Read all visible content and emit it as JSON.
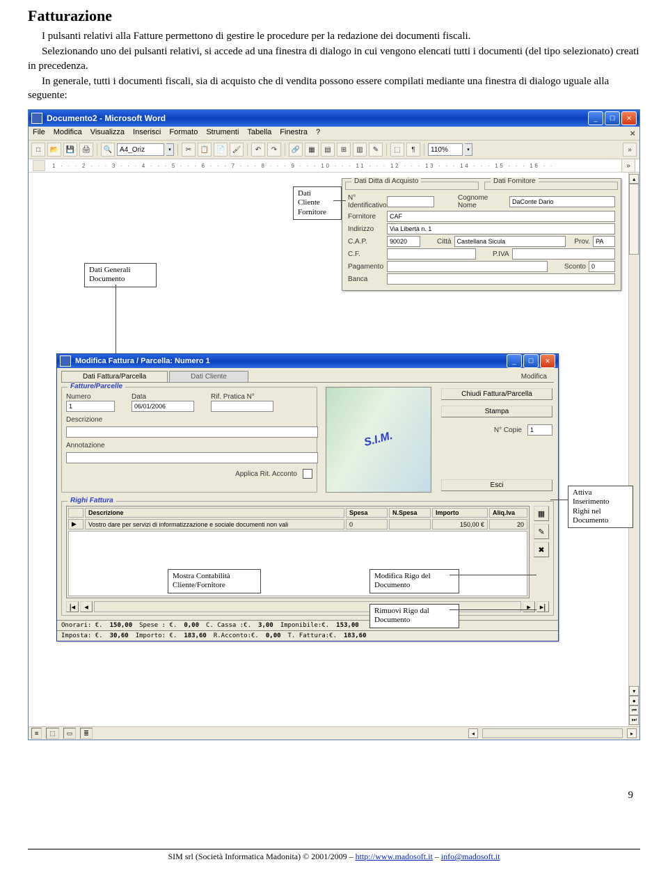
{
  "heading": "Fatturazione",
  "para1": "I pulsanti relativi alla Fatture permettono di gestire le procedure per la redazione dei documenti fiscali.",
  "para2": "Selezionando uno dei pulsanti relativi, si accede ad una finestra di dialogo in cui vengono elencati tutti i documenti (del tipo selezionato) creati in precedenza.",
  "para3": "In generale, tutti i documenti fiscali, sia di acquisto che di vendita possono essere compilati mediante una finestra di dialogo uguale alla seguente:",
  "word": {
    "title": "Documento2 - Microsoft Word",
    "menu": [
      "File",
      "Modifica",
      "Visualizza",
      "Inserisci",
      "Formato",
      "Strumenti",
      "Tabella",
      "Finestra",
      "?"
    ],
    "page_size": "A4_Oriz",
    "zoom": "110%",
    "ruler": "1 · · · 2 · · · 3 · · · 4 · · · 5 · · · 6 · · · 7 · · · 8 · · · 9 · · · 10 · · · 11 · · · 12 · · · 13 · · · 14 · · · 15 · · · 16 · ·"
  },
  "callouts": {
    "dati_cliente": "Dati\nCliente\nFornitore",
    "dati_generali": "Dati Generali\nDocumento",
    "attiva": "Attiva\nInserimento\nRighi nel\nDocumento",
    "mostra": "Mostra Contabilità\nCliente/Fornitore",
    "modifica_rigo": "Modifica Rigo del\nDocumento",
    "rimuovi_rigo": "Rimuovi Rigo dal\nDocumento"
  },
  "ditta": {
    "group1": "Dati Ditta di Acquisto",
    "group2": "Dati Fornitore",
    "nid": "N° Identificativo",
    "nid_val": "",
    "cognome": "Cognome Nome",
    "cognome_val": "DaConte Dario",
    "fornitore": "Fornitore",
    "fornitore_val": "CAF",
    "indirizzo": "Indirizzo",
    "indirizzo_val": "Via Libertà n. 1",
    "cap": "C.A.P.",
    "cap_val": "90020",
    "citta": "Città",
    "citta_val": "Castellana Sicula",
    "prov": "Prov.",
    "prov_val": "PA",
    "cf": "C.F.",
    "piva": "P.IVA",
    "pagamento": "Pagamento",
    "sconto": "Sconto",
    "sconto_val": "0",
    "banca": "Banca"
  },
  "dialog": {
    "title": "Modifica Fattura / Parcella: Numero 1",
    "tab1": "Dati Fattura/Parcella",
    "tab2": "Dati Cliente",
    "tab_mod": "Modifica",
    "section": "Fatture/Parcelle",
    "numero": "Numero",
    "numero_val": "1",
    "data": "Data",
    "data_val": "06/01/2006",
    "rif": "Rif. Pratica N°",
    "descrizione": "Descrizione",
    "annotazione": "Annotazione",
    "applica": "Applica Rit. Acconto",
    "sim": "S.I.M.",
    "btn_chiudi": "Chiudi Fattura/Parcella",
    "btn_stampa": "Stampa",
    "ncopie": "N° Copie",
    "ncopie_val": "1",
    "btn_esci": "Esci",
    "righi": "Righi Fattura",
    "cols": [
      "",
      "Descrizione",
      "Spesa",
      "N.Spesa",
      "Importo",
      "Aliq.Iva"
    ],
    "row": [
      "▶",
      "Vostro dare per servizi di informatizzazione e sociale documenti non vali",
      "0",
      "",
      "150,00 €",
      "20"
    ],
    "totals_top": [
      "Onorari: €.",
      "150,00",
      "Spese   : €.",
      "0,00",
      "C. Cassa  :€.",
      "3,00",
      "Imponibile:€.",
      "153,00"
    ],
    "totals_bot": [
      "Imposta: €.",
      "30,60",
      "Importo: €.",
      "183,60",
      "R.Acconto:€.",
      "0,00",
      "T. Fattura:€.",
      "183,60"
    ]
  },
  "footer": {
    "text_a": "SIM srl (Società Informatica Madonita) © 2001/2009 – ",
    "link1": "http://www.madosoft.it",
    "sep": " – ",
    "link2": "info@madosoft.it",
    "pagenum": "9"
  }
}
